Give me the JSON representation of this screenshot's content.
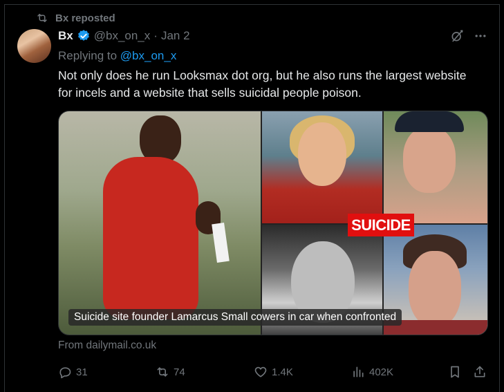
{
  "repost_label": "Bx reposted",
  "author": {
    "name": "Bx",
    "handle": "@bx_on_x",
    "separator": "·",
    "date": "Jan 2"
  },
  "reply": {
    "prefix": "Replying to",
    "handle": "@bx_on_x"
  },
  "tweet_text": "Not only does he run Looksmax dot org, but he also runs the largest website for incels and a website that sells suicidal people poison.",
  "media": {
    "overlay_label": "SUICIDE",
    "caption": "Suicide site founder Lamarcus Small cowers in car when confronted",
    "source": "From dailymail.co.uk"
  },
  "actions": {
    "replies": "31",
    "reposts": "74",
    "likes": "1.4K",
    "views": "402K"
  },
  "icons": {
    "repost": "repost-icon",
    "verified": "verified-badge-icon",
    "grok": "grok-icon",
    "more": "more-icon",
    "reply": "reply-icon",
    "like": "heart-icon",
    "views": "views-icon",
    "bookmark": "bookmark-icon",
    "share": "share-icon"
  },
  "colors": {
    "background": "#000000",
    "text": "#e7e9ea",
    "secondary": "#71767b",
    "accent": "#1d9bf0",
    "overlay_red": "#e10f0f"
  }
}
